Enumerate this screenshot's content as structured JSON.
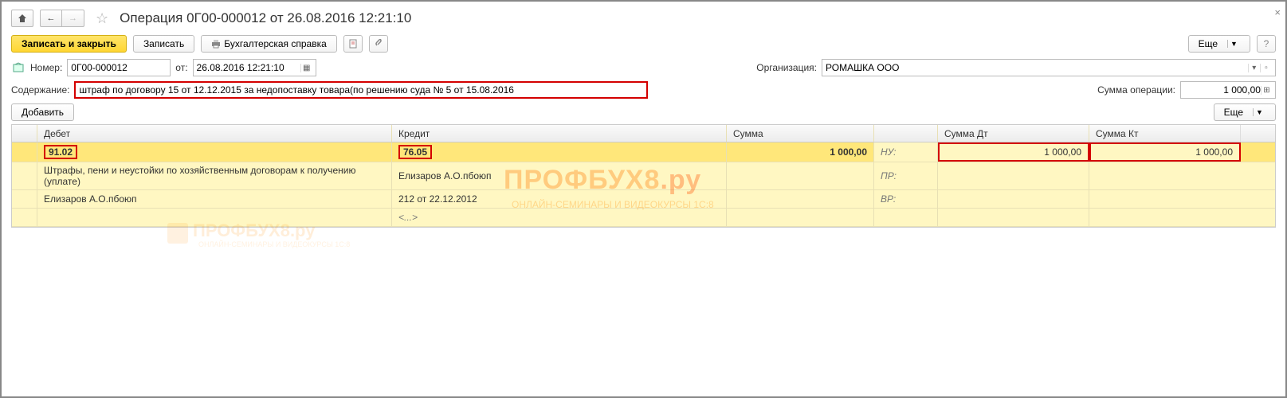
{
  "window": {
    "title": "Операция 0Г00-000012 от 26.08.2016 12:21:10",
    "close": "×"
  },
  "toolbar": {
    "save_close": "Записать и закрыть",
    "save": "Записать",
    "acc_ref": "Бухгалтерская справка",
    "more": "Еще",
    "help": "?"
  },
  "fields": {
    "number_label": "Номер:",
    "number_value": "0Г00-000012",
    "date_label": "от:",
    "date_value": "26.08.2016 12:21:10",
    "org_label": "Организация:",
    "org_value": "РОМАШКА ООО",
    "content_label": "Содержание:",
    "content_value": "штраф по договору 15 от 12.12.2015 за недопоставку товара(по решению суда № 5 от 15.08.2016",
    "sum_label": "Сумма операции:",
    "sum_value": "1 000,00"
  },
  "tableToolbar": {
    "add": "Добавить",
    "more": "Еще"
  },
  "headers": {
    "debit": "Дебет",
    "credit": "Кредит",
    "sum": "Сумма",
    "sum_dt": "Сумма Дт",
    "sum_kt": "Сумма Кт"
  },
  "rows": {
    "r1": {
      "debit_acct": "91.02",
      "credit_acct": "76.05",
      "sum": "1 000,00",
      "tag": "НУ:",
      "sum_dt": "1 000,00",
      "sum_kt": "1 000,00"
    },
    "r2": {
      "debit_txt": "Штрафы, пени и неустойки по хозяйственным договорам к получению (уплате)",
      "credit_txt": "Елизаров А.О.пбоюп",
      "tag": "ПР:"
    },
    "r3": {
      "debit_txt": "Елизаров А.О.пбоюп",
      "credit_txt": "212 от 22.12.2012",
      "tag": "ВР:"
    },
    "r4": {
      "credit_txt": "<...>"
    }
  }
}
